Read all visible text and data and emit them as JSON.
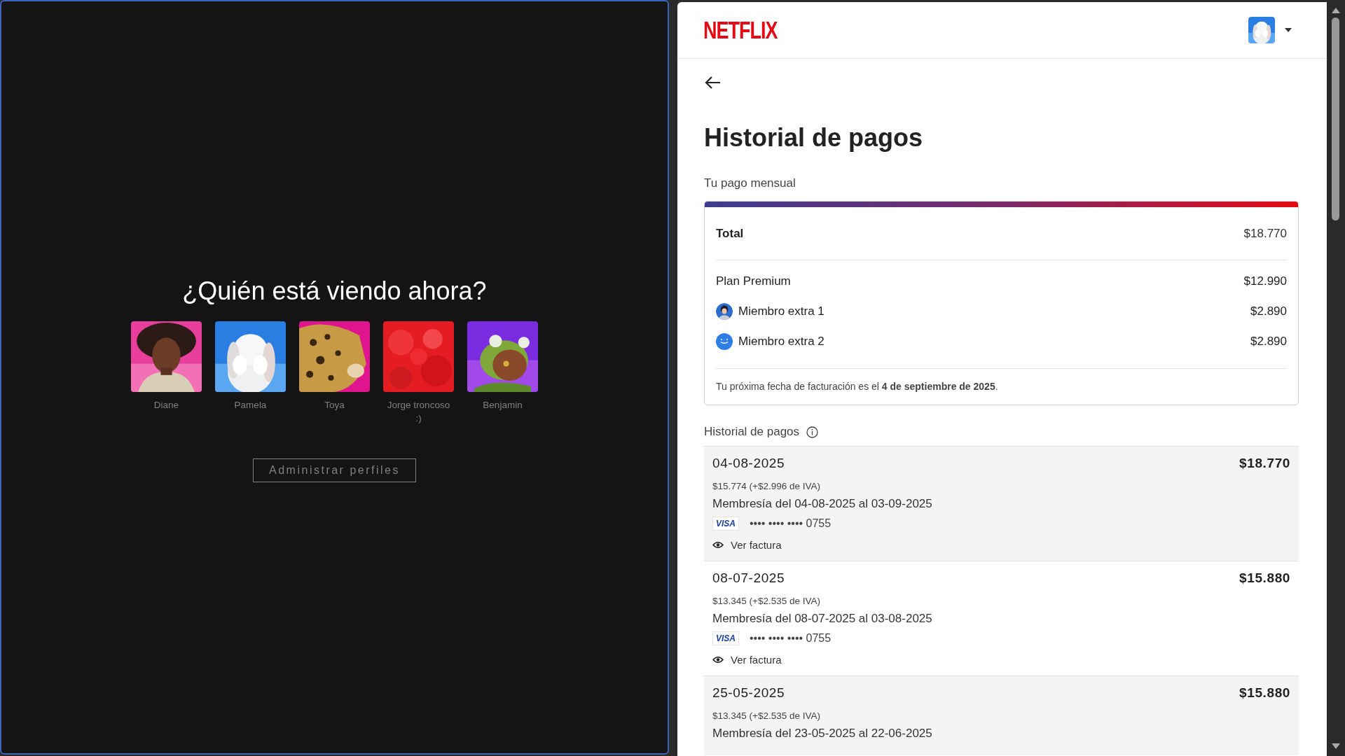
{
  "profiles_screen": {
    "title": "¿Quién está viendo ahora?",
    "profiles": [
      {
        "name": "Diane"
      },
      {
        "name": "Pamela"
      },
      {
        "name": "Toya"
      },
      {
        "name": "Jorge troncoso :)"
      },
      {
        "name": "Benjamin"
      }
    ],
    "manage_button": "Administrar perfiles"
  },
  "account": {
    "logo": "NETFLIX",
    "title": "Historial de pagos",
    "monthly_label": "Tu pago mensual",
    "summary": {
      "total_label": "Total",
      "total": "$18.770",
      "items": [
        {
          "kind": "plan",
          "label": "Plan Premium",
          "amount": "$12.990"
        },
        {
          "label": "Miembro extra 1",
          "amount": "$2.890"
        },
        {
          "kind": "smiley",
          "label": "Miembro extra 2",
          "amount": "$2.890"
        }
      ],
      "next_billing": "Tu próxima fecha de facturación es el **4 de septiembre de 2025**."
    },
    "history_label": "Historial de pagos",
    "payments": [
      {
        "date": "04-08-2025",
        "amount": "$18.770",
        "breakdown": "$15.774 (+$2.996 de IVA)",
        "period": "Membresía del 04-08-2025 al 03-09-2025",
        "card_brand": "VISA",
        "card_number": "•••• •••• •••• 0755",
        "invoice_link": "Ver factura"
      },
      {
        "date": "08-07-2025",
        "amount": "$15.880",
        "breakdown": "$13.345 (+$2.535 de IVA)",
        "period": "Membresía del 08-07-2025 al 03-08-2025",
        "card_brand": "VISA",
        "card_number": "•••• •••• •••• 0755",
        "invoice_link": "Ver factura"
      },
      {
        "date": "25-05-2025",
        "amount": "$15.880",
        "breakdown": "$13.345 (+$2.535 de IVA)",
        "period": "Membresía del 23-05-2025 al 22-06-2025"
      }
    ]
  }
}
